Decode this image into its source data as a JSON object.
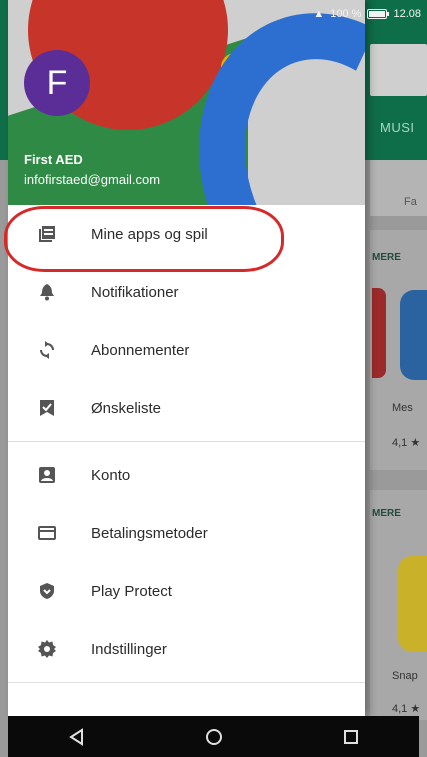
{
  "status_bar": {
    "battery": "100 %",
    "time": "12.08"
  },
  "background": {
    "tab_fragment": "MUSI",
    "category_fragment": "Fa",
    "more_label_1": "MERE",
    "more_label_2": "MERE",
    "app_label_1": "Mes",
    "app_rating_1": "4,1 ★",
    "app_label_2": "Snap",
    "app_rating_2": "4,1 ★"
  },
  "drawer": {
    "avatar_letter": "F",
    "account_name": "First AED",
    "account_email": "infofirstaed@gmail.com",
    "menu_items": [
      {
        "label": "Mine apps og spil",
        "icon": "apps-icon"
      },
      {
        "label": "Notifikationer",
        "icon": "bell-icon"
      },
      {
        "label": "Abonnementer",
        "icon": "refresh-icon"
      },
      {
        "label": "Ønskeliste",
        "icon": "wishlist-icon"
      },
      {
        "label": "Konto",
        "icon": "account-icon"
      },
      {
        "label": "Betalingsmetoder",
        "icon": "card-icon"
      },
      {
        "label": "Play Protect",
        "icon": "shield-icon"
      },
      {
        "label": "Indstillinger",
        "icon": "gear-icon"
      }
    ]
  },
  "colors": {
    "highlight": "#d62a2a",
    "avatar": "#5b2d97",
    "header_green": "#0f6e4a"
  }
}
